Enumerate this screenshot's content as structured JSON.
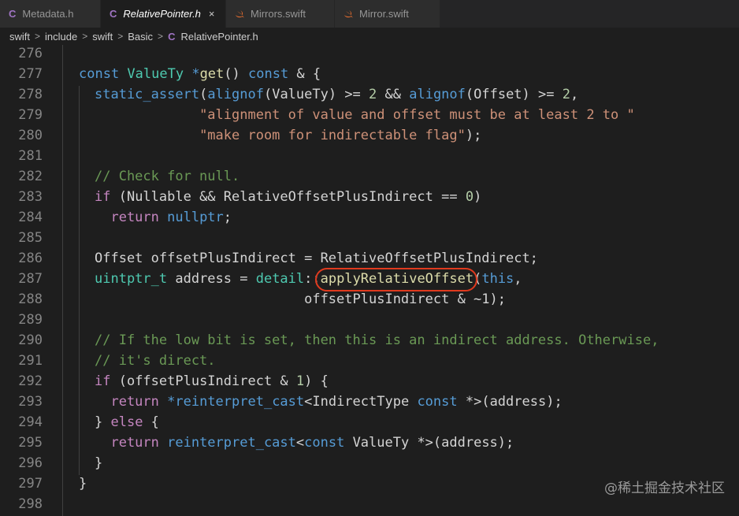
{
  "tabs": [
    {
      "label": "Metadata.h",
      "icon": "c-header-icon",
      "glyph": "C"
    },
    {
      "label": "RelativePointer.h",
      "icon": "c-header-icon",
      "glyph": "C",
      "active": true,
      "close": "×"
    },
    {
      "label": "Mirrors.swift",
      "icon": "swift-icon"
    },
    {
      "label": "Mirror.swift",
      "icon": "swift-icon"
    }
  ],
  "breadcrumb": {
    "items": [
      "swift",
      "include",
      "swift",
      "Basic"
    ],
    "file_glyph": "C",
    "file": "RelativePointer.h",
    "separator": ">"
  },
  "editor": {
    "line_numbers": [
      "276",
      "277",
      "278",
      "279",
      "280",
      "281",
      "282",
      "283",
      "284",
      "285",
      "286",
      "287",
      "288",
      "289",
      "290",
      "291",
      "292",
      "293",
      "294",
      "295",
      "296",
      "297",
      "298"
    ],
    "highlight_target": "applyRelativeOffset"
  },
  "colors": {
    "keyword": "#569cd6",
    "control": "#c586c0",
    "type": "#4ec9b0",
    "function": "#dcdcaa",
    "string": "#ce9178",
    "comment": "#6a9955",
    "number": "#b5cea8",
    "annotation": "#e03a1e"
  },
  "watermark": "@稀土掘金技术社区"
}
